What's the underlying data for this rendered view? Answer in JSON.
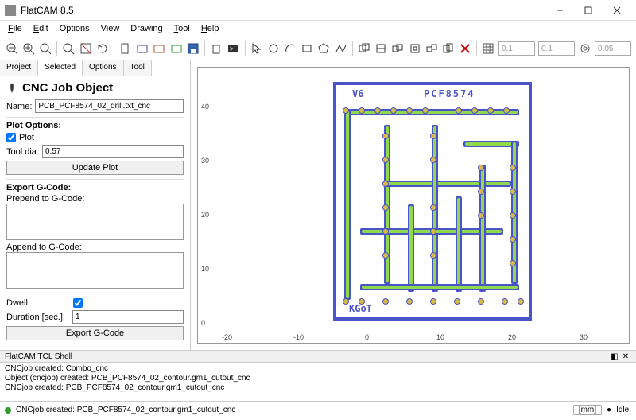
{
  "window": {
    "title": "FlatCAM 8.5"
  },
  "menu": {
    "file": "File",
    "edit": "Edit",
    "options": "Options",
    "view": "View",
    "drawing": "Drawing",
    "tool": "Tool",
    "help": "Help"
  },
  "toolbar": {
    "val1": "0.1",
    "val2": "0.1",
    "val3": "0.05"
  },
  "tabs": {
    "project": "Project",
    "selected": "Selected",
    "options": "Options",
    "tool": "Tool"
  },
  "panel": {
    "heading": "CNC Job Object",
    "name_label": "Name:",
    "name_value": "PCB_PCF8574_02_drill.txt_cnc",
    "plot_options": "Plot Options:",
    "plot_label": "Plot",
    "tool_dia_label": "Tool dia:",
    "tool_dia_value": "0.57",
    "update_plot": "Update Plot",
    "export_gcode_hdr": "Export G-Code:",
    "prepend_label": "Prepend to G-Code:",
    "prepend_value": "",
    "append_label": "Append to G-Code:",
    "append_value": "",
    "dwell_label": "Dwell:",
    "duration_label": "Duration [sec.]:",
    "duration_value": "1",
    "export_gcode_btn": "Export G-Code"
  },
  "plot": {
    "x_ticks": [
      "-20",
      "-10",
      "0",
      "10",
      "20",
      "30"
    ],
    "y_ticks": [
      "0",
      "10",
      "20",
      "30",
      "40"
    ],
    "silk1": "V6",
    "silk2": "PCF8574",
    "silk3": "KGoT"
  },
  "shell": {
    "title": "FlatCAM TCL Shell",
    "lines": [
      "CNCjob created: Combo_cnc",
      "Object (cncjob) created: PCB_PCF8574_02_contour.gm1_cutout_cnc",
      "CNCjob created: PCB_PCF8574_02_contour.gm1_cutout_cnc"
    ]
  },
  "status": {
    "msg": "CNCjob created: PCB_PCF8574_02_contour.gm1_cutout_cnc",
    "units": "[mm]",
    "state": "Idle."
  }
}
